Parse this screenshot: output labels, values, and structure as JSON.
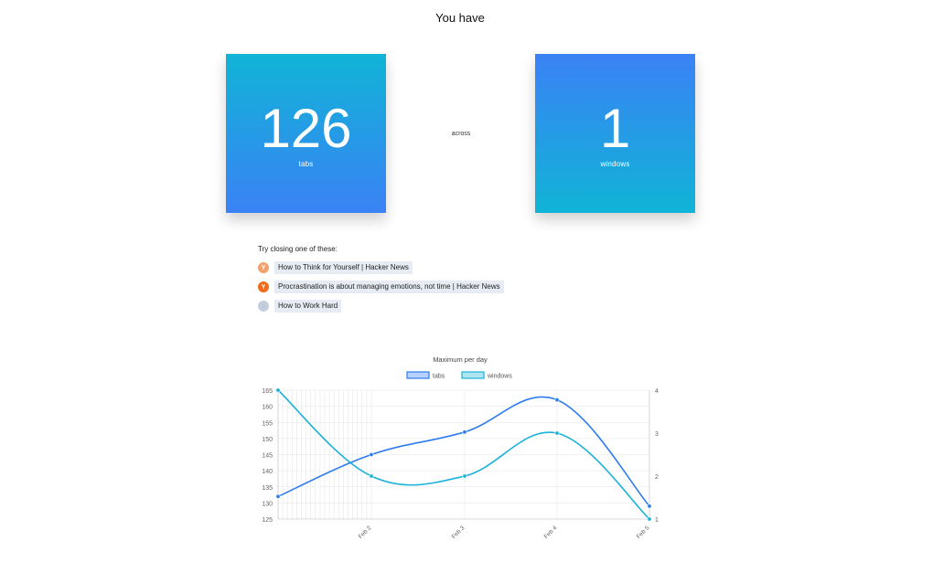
{
  "header": {
    "title": "You have"
  },
  "stats": {
    "tabs": {
      "value": "126",
      "label": "tabs"
    },
    "connector": "across",
    "windows": {
      "value": "1",
      "label": "windows"
    }
  },
  "suggestions": {
    "title": "Try closing one of these:",
    "items": [
      {
        "icon": "hacker-news-icon",
        "glyph": "Y",
        "label": "How to Think for Yourself | Hacker News"
      },
      {
        "icon": "hacker-news-icon",
        "glyph": "Y",
        "label": "Procrastination is about managing emotions, not time | Hacker News"
      },
      {
        "icon": "globe-icon",
        "glyph": "◌",
        "label": "How to Work Hard"
      }
    ]
  },
  "colors": {
    "tabs_series": "#2f7cf0",
    "windows_series": "#1ab2d8",
    "accent_gradient_a": "#10b4d6",
    "accent_gradient_b": "#3a82f5"
  },
  "chart_data": {
    "type": "line",
    "title": "Maximum per day",
    "legend_position": "top-center",
    "x": [
      "Jan 31",
      "Feb 1",
      "Feb 2",
      "Feb 3",
      "Feb 4",
      "Feb 5"
    ],
    "x_tick_labels": [
      "",
      "",
      "Feb 2",
      "Feb 3",
      "Feb 4",
      "Feb 5"
    ],
    "series": [
      {
        "name": "tabs",
        "axis": "left",
        "values": [
          132,
          null,
          145,
          152,
          162,
          129
        ]
      },
      {
        "name": "windows",
        "axis": "right",
        "values": [
          4,
          null,
          2,
          2,
          3,
          1
        ]
      }
    ],
    "y_left": {
      "ticks": [
        "125",
        "130",
        "135",
        "140",
        "145",
        "150",
        "155",
        "160",
        "165"
      ],
      "range": [
        125,
        165
      ]
    },
    "y_right": {
      "ticks": [
        "1",
        "2",
        "3",
        "4"
      ],
      "range": [
        1,
        4
      ]
    },
    "grid": true
  }
}
